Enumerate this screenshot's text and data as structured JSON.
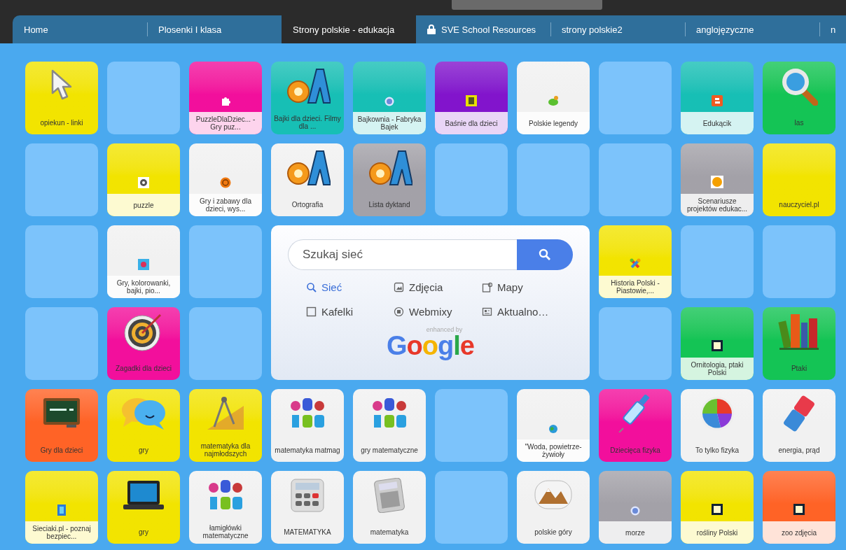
{
  "tabs": [
    {
      "label": "Home",
      "selected": false,
      "locked": false
    },
    {
      "label": "Plosenki I klasa",
      "selected": false,
      "locked": false
    },
    {
      "label": "Strony polskie - edukacja",
      "selected": true,
      "locked": false
    },
    {
      "label": "SVE School Resources",
      "selected": false,
      "locked": true
    },
    {
      "label": "strony polskie2",
      "selected": false,
      "locked": false
    },
    {
      "label": "anglojęzyczne",
      "selected": false,
      "locked": false
    },
    {
      "label": "n",
      "selected": false,
      "locked": false
    }
  ],
  "tiles": [
    {
      "kind": "link",
      "label": "opiekun - linki",
      "color": "#f2e400",
      "banded": false
    },
    {
      "kind": "empty"
    },
    {
      "kind": "link",
      "label": "PuzzleDlaDziec... - Gry puz...",
      "color": "#f20f9c",
      "banded": true
    },
    {
      "kind": "link",
      "label": "Bajki dla dzieci. Filmy dla ...",
      "color": "#17bfb5",
      "banded": false
    },
    {
      "kind": "link",
      "label": "Bajkownia - Fabryka Bajek",
      "color": "#17bfb5",
      "banded": true
    },
    {
      "kind": "link",
      "label": "Baśnie dla dzieci",
      "color": "#8214cc",
      "banded": true
    },
    {
      "kind": "link",
      "label": "Polskie legendy",
      "color": "#f1f1f1",
      "banded": true
    },
    {
      "kind": "empty"
    },
    {
      "kind": "link",
      "label": "Edukącik",
      "color": "#17bfb5",
      "banded": true
    },
    {
      "kind": "link",
      "label": "las",
      "color": "#14c455",
      "banded": false
    },
    {
      "kind": "empty"
    },
    {
      "kind": "link",
      "label": "puzzle",
      "color": "#f2e400",
      "banded": true
    },
    {
      "kind": "link",
      "label": "Gry i zabawy dla dzieci, wys...",
      "color": "#f1f1f1",
      "banded": true
    },
    {
      "kind": "link",
      "label": "Ortografia",
      "color": "#f1f1f1",
      "banded": false
    },
    {
      "kind": "link",
      "label": "Lista dyktand",
      "color": "#a3a1a8",
      "banded": false
    },
    {
      "kind": "empty"
    },
    {
      "kind": "empty"
    },
    {
      "kind": "empty"
    },
    {
      "kind": "link",
      "label": "Scenariusze projektów edukac...",
      "color": "#a3a1a8",
      "banded": true
    },
    {
      "kind": "link",
      "label": "nauczyciel.pl",
      "color": "#f2e400",
      "banded": false
    },
    {
      "kind": "empty"
    },
    {
      "kind": "link",
      "label": "Gry, kolorowanki, bajki, pio...",
      "color": "#f1f1f1",
      "banded": true
    },
    {
      "kind": "empty"
    },
    {
      "kind": "link",
      "label": "Historia Polski - Piastowie,...",
      "color": "#f2e400",
      "banded": true
    },
    {
      "kind": "empty"
    },
    {
      "kind": "empty"
    },
    {
      "kind": "empty"
    },
    {
      "kind": "link",
      "label": "Zagadki dla dzieci",
      "color": "#f20f9c",
      "banded": false
    },
    {
      "kind": "empty"
    },
    {
      "kind": "empty"
    },
    {
      "kind": "link",
      "label": "Ornitologia, ptaki Polski",
      "color": "#14c455",
      "banded": true
    },
    {
      "kind": "link",
      "label": "Ptaki",
      "color": "#14c455",
      "banded": false
    },
    {
      "kind": "link",
      "label": "Gry dla dzieci",
      "color": "#ff6326",
      "banded": false
    },
    {
      "kind": "link",
      "label": "gry",
      "color": "#f2e400",
      "banded": false
    },
    {
      "kind": "link",
      "label": "matematyka dla najmłodszych",
      "color": "#f2e400",
      "banded": false
    },
    {
      "kind": "link",
      "label": "matematyka matmag",
      "color": "#f1f1f1",
      "banded": false
    },
    {
      "kind": "link",
      "label": "gry matematyczne",
      "color": "#f1f1f1",
      "banded": false
    },
    {
      "kind": "empty"
    },
    {
      "kind": "link",
      "label": "\"Woda, powietrze- żywioły",
      "color": "#f1f1f1",
      "banded": true
    },
    {
      "kind": "link",
      "label": "Dziecięca fizyka",
      "color": "#f20f9c",
      "banded": false
    },
    {
      "kind": "link",
      "label": "To tylko fizyka",
      "color": "#f1f1f1",
      "banded": false
    },
    {
      "kind": "link",
      "label": "energia, prąd",
      "color": "#f1f1f1",
      "banded": false
    },
    {
      "kind": "link",
      "label": "Sieciaki.pl - poznaj bezpiec...",
      "color": "#f2e400",
      "banded": true
    },
    {
      "kind": "link",
      "label": "gry",
      "color": "#f2e400",
      "banded": false
    },
    {
      "kind": "link",
      "label": "łamigłówki matematyczne",
      "color": "#f1f1f1",
      "banded": false
    },
    {
      "kind": "link",
      "label": "MATEMATYKA",
      "color": "#f1f1f1",
      "banded": false
    },
    {
      "kind": "link",
      "label": "matematyka",
      "color": "#f1f1f1",
      "banded": false
    },
    {
      "kind": "empty"
    },
    {
      "kind": "link",
      "label": "polskie góry",
      "color": "#f1f1f1",
      "banded": false
    },
    {
      "kind": "link",
      "label": "morze",
      "color": "#a3a1a8",
      "banded": true
    },
    {
      "kind": "link",
      "label": "rośliny Polski",
      "color": "#f2e400",
      "banded": true
    },
    {
      "kind": "link",
      "label": "zoo zdjęcia",
      "color": "#ff6326",
      "banded": true
    }
  ],
  "search": {
    "placeholder": "Szukaj sieć",
    "options": [
      {
        "label": "Sieć",
        "selected": true
      },
      {
        "label": "Zdjęcia",
        "selected": false
      },
      {
        "label": "Mapy",
        "selected": false
      },
      {
        "label": "Kafelki",
        "selected": false
      },
      {
        "label": "Webmixy",
        "selected": false
      },
      {
        "label": "Aktualno…",
        "selected": false
      }
    ],
    "enhanced_by": "enhanced by",
    "logo": "Google"
  }
}
